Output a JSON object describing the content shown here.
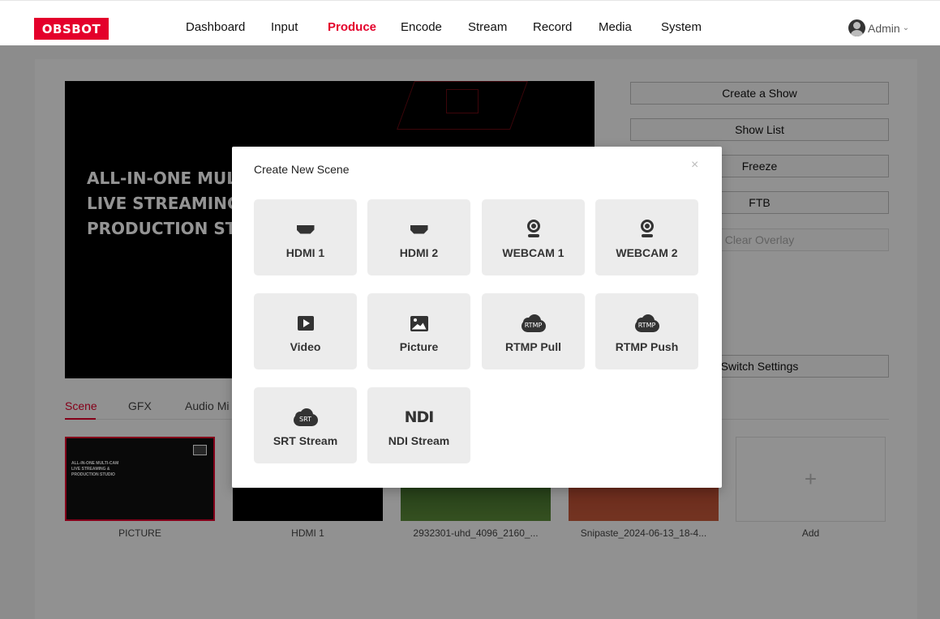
{
  "brand": {
    "logo_text": "OBSBOT"
  },
  "nav": {
    "items": [
      {
        "label": "Dashboard"
      },
      {
        "label": "Input"
      },
      {
        "label": "Produce"
      },
      {
        "label": "Encode"
      },
      {
        "label": "Stream"
      },
      {
        "label": "Record"
      },
      {
        "label": "Media"
      },
      {
        "label": "System"
      }
    ],
    "active": "Produce"
  },
  "user": {
    "name": "Admin"
  },
  "preview": {
    "hero_text": [
      "ALL-IN-ONE MUL",
      "LIVE STREAMING",
      "PRODUCTION ST"
    ]
  },
  "side_buttons": {
    "create_show": "Create a Show",
    "show_list": "Show List",
    "freeze": "Freeze",
    "ftb": "FTB",
    "clear_overlay": "Clear Overlay",
    "switch_settings": "Switch Settings"
  },
  "tabs": [
    {
      "label": "Scene"
    },
    {
      "label": "GFX"
    },
    {
      "label": "Audio Mi"
    }
  ],
  "scenes": [
    {
      "label": "PICTURE",
      "thumb_text": [
        "ALL-IN-ONE MULTI-CAM",
        "LIVE STREAMING &",
        "PRODUCTION STUDIO"
      ]
    },
    {
      "label": "HDMI 1"
    },
    {
      "label": "2932301-uhd_4096_2160_..."
    },
    {
      "label": "Snipaste_2024-06-13_18-4..."
    },
    {
      "label": "Add",
      "plus": "+"
    }
  ],
  "modal": {
    "title": "Create New Scene",
    "close": "×",
    "tiles": [
      {
        "label": "HDMI 1",
        "icon": "hdmi-icon"
      },
      {
        "label": "HDMI 2",
        "icon": "hdmi-icon"
      },
      {
        "label": "WEBCAM 1",
        "icon": "webcam-icon"
      },
      {
        "label": "WEBCAM 2",
        "icon": "webcam-icon"
      },
      {
        "label": "Video",
        "icon": "play-icon"
      },
      {
        "label": "Picture",
        "icon": "picture-icon"
      },
      {
        "label": "RTMP Pull",
        "icon": "rtmp-cloud-icon",
        "badge": "RTMP"
      },
      {
        "label": "RTMP Push",
        "icon": "rtmp-cloud-icon",
        "badge": "RTMP"
      },
      {
        "label": "SRT Stream",
        "icon": "srt-cloud-icon",
        "badge": "SRT"
      },
      {
        "label": "NDI Stream",
        "icon": "ndi-icon",
        "badge": "NDI"
      }
    ]
  },
  "colors": {
    "accent": "#e4002b"
  }
}
